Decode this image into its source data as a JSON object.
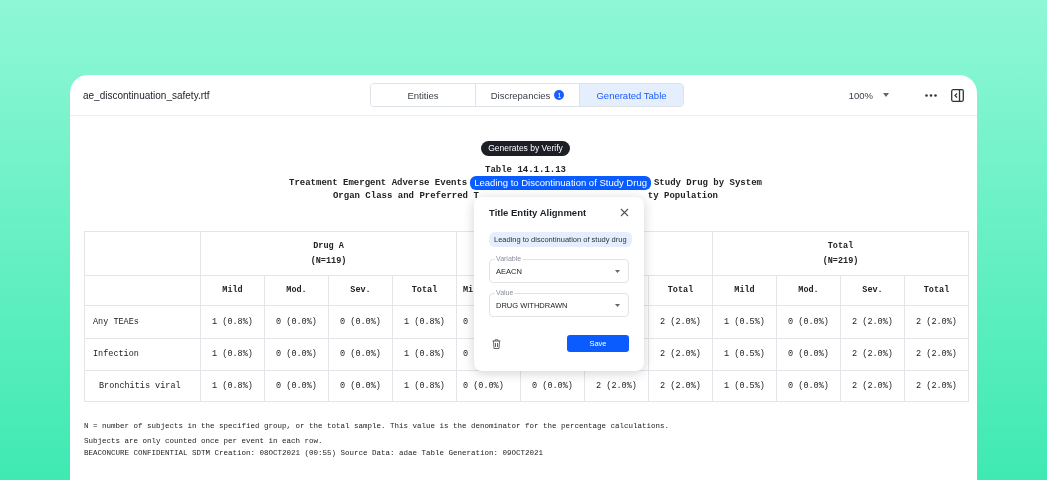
{
  "file_name": "ae_discontinuation_safety.rtf",
  "tabs": [
    {
      "label": "Entities",
      "selected": false
    },
    {
      "label": "Discrepancies",
      "badge": "1",
      "selected": false
    },
    {
      "label": "Generated Table",
      "selected": true
    }
  ],
  "zoom": "100%",
  "document": {
    "badge": "Generates by Verify",
    "table_number": "Table 14.1.1.13",
    "title_lines": [
      [
        {
          "kind": "text",
          "text": "Treatment Emergent Adverse Events"
        },
        {
          "kind": "highlight",
          "text": "Leading to Discontinuation of Study Drug"
        },
        {
          "kind": "text",
          "text": "Study Drug by System"
        }
      ],
      [
        {
          "kind": "text",
          "text": "Organ Class and Preferred T"
        },
        {
          "kind": "covered"
        },
        {
          "kind": "text",
          "text": "ty Population"
        }
      ]
    ],
    "table": {
      "groups": [
        {
          "kind": "labelled",
          "label": "Drug A",
          "n": "(N=119)"
        },
        {
          "kind": "covered"
        },
        {
          "kind": "labelled",
          "label": "Total",
          "n": "(N=219)"
        }
      ],
      "columns": [
        "Mild",
        "Mod.",
        "Sev.",
        "Total",
        "Mi",
        null,
        null,
        "Total",
        "Mild",
        "Mod.",
        "Sev.",
        "Total"
      ],
      "rows": [
        {
          "label": "Any TEAEs",
          "cells": [
            "1 (0.8%)",
            "0 (0.0%)",
            "0 (0.0%)",
            "1 (0.8%)",
            "0",
            null,
            null,
            "2 (2.0%)",
            "1 (0.5%)",
            "0 (0.0%)",
            "2 (2.0%)",
            "2 (2.0%)"
          ]
        },
        {
          "label": "Infection",
          "cells": [
            "1 (0.8%)",
            "0 (0.0%)",
            "0 (0.0%)",
            "1 (0.8%)",
            "0",
            null,
            null,
            "2 (2.0%)",
            "1 (0.5%)",
            "0 (0.0%)",
            "2 (2.0%)",
            "2 (2.0%)"
          ]
        },
        {
          "label": "Bronchitis viral",
          "cells": [
            "1 (0.8%)",
            "0 (0.0%)",
            "0 (0.0%)",
            "1 (0.8%)",
            "0 (0.0%)",
            "0 (0.0%)",
            "2 (2.0%)",
            "2 (2.0%)",
            "1 (0.5%)",
            "0 (0.0%)",
            "2 (2.0%)",
            "2 (2.0%)"
          ]
        }
      ]
    },
    "footnotes": [
      "N = number of subjects in the specified group, or the total sample. This value is the denominator for the percentage calculations.",
      "Subjects are only counted once per event in each row.",
      "BEACONCURE CONFIDENTIAL SDTM Creation: 08OCT2021 (00:55) Source Data: adae Table Generation: 09OCT2021"
    ]
  },
  "popup": {
    "title": "Title Entity Alignment",
    "entity": "Leading to discontinuation of study drug",
    "fields": [
      {
        "label": "Variable",
        "value": "AEACN"
      },
      {
        "label": "Value",
        "value": "DRUG WITHDRAWN"
      }
    ],
    "save": "Save"
  }
}
